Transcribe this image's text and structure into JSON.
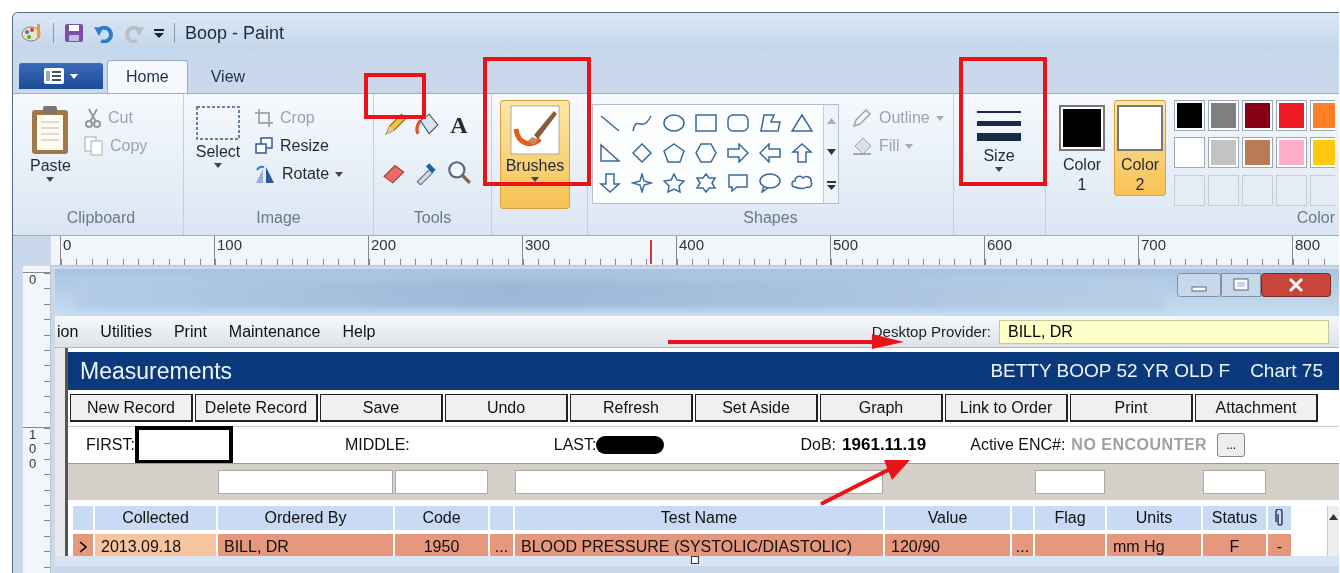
{
  "window": {
    "title": "Boop - Paint"
  },
  "ribbon_tabs": [
    {
      "label": "Home",
      "selected": true
    },
    {
      "label": "View",
      "selected": false
    }
  ],
  "clipboard": {
    "label": "Clipboard",
    "paste": "Paste",
    "cut": {
      "label": "Cut",
      "disabled": true
    },
    "copy": {
      "label": "Copy",
      "disabled": true
    }
  },
  "image": {
    "label": "Image",
    "select": "Select",
    "crop": {
      "label": "Crop",
      "disabled": true
    },
    "resize": {
      "label": "Resize",
      "disabled": false
    },
    "rotate": {
      "label": "Rotate",
      "disabled": false
    }
  },
  "tools": {
    "label": "Tools",
    "text_tool": "A"
  },
  "brushes": {
    "label": "Brushes",
    "selected": true
  },
  "shapes": {
    "label": "Shapes",
    "outline": {
      "label": "Outline",
      "disabled": true
    },
    "fill": {
      "label": "Fill",
      "disabled": true
    }
  },
  "size": {
    "label": "Size",
    "selected": false
  },
  "colors": {
    "label": "Color",
    "slots": [
      {
        "label": "Color 1",
        "color": "#000000",
        "selected": false
      },
      {
        "label": "Color 2",
        "color": "#ffffff",
        "selected": true
      }
    ],
    "palette": [
      [
        {
          "color": "#000000"
        },
        {
          "color": "#7f7f7f"
        },
        {
          "color": "#880015"
        },
        {
          "color": "#ed1c24"
        },
        {
          "color": "#ff7f27"
        }
      ],
      [
        {
          "color": "#ffffff"
        },
        {
          "color": "#c3c3c3"
        },
        {
          "color": "#b97a57"
        },
        {
          "color": "#ffaec9"
        },
        {
          "color": "#ffc90e"
        }
      ],
      [
        {
          "kind": "empty"
        },
        {
          "kind": "empty"
        },
        {
          "kind": "empty"
        },
        {
          "kind": "empty"
        },
        {
          "kind": "empty"
        }
      ]
    ]
  },
  "ruler": {
    "marks": [
      "0",
      "100",
      "200",
      "300",
      "400",
      "500",
      "600",
      "700",
      "800"
    ]
  },
  "vertical_ruler": {
    "marks": [
      "0",
      "100"
    ]
  },
  "app": {
    "menu": [
      "ion",
      "Utilities",
      "Print",
      "Maintenance",
      "Help"
    ],
    "provider": {
      "label": "Desktop Provider:",
      "value": "BILL, DR"
    },
    "header": {
      "title": "Measurements",
      "patient": "BETTY BOOP 52 YR OLD F",
      "chart": "Chart 75"
    },
    "buttons": [
      "New Record",
      "Delete Record",
      "Save",
      "Undo",
      "Refresh",
      "Set Aside",
      "Graph",
      "Link to Order",
      "Print",
      "Attachment"
    ],
    "patient": {
      "first": "FIRST:",
      "middle": "MIDDLE:",
      "last": "LAST:",
      "dob_label": "DoB:",
      "dob": "1961.11.19",
      "enc_label": "Active ENC#:",
      "enc": "NO ENCOUNTER",
      "lookup": "..."
    },
    "table": {
      "columns": [
        {
          "kind": "indicator"
        },
        {
          "label": "Collected"
        },
        {
          "label": "Ordered By",
          "filter": true
        },
        {
          "label": "Code",
          "filter": true
        },
        {
          "kind": "blank"
        },
        {
          "label": "Test Name",
          "filter": true
        },
        {
          "label": "Value"
        },
        {
          "kind": "blank"
        },
        {
          "label": "Flag",
          "filter": true
        },
        {
          "label": "Units"
        },
        {
          "label": "Status",
          "filter": true
        },
        {
          "kind": "attachment"
        }
      ],
      "rows": [
        {
          "cells": [
            {
              "kind": "pointer"
            },
            {
              "text": "2013.09.18",
              "focused": true
            },
            {
              "text": "BILL, DR"
            },
            {
              "text": "1950"
            },
            {
              "text": "..."
            },
            {
              "text": "BLOOD PRESSURE (SYSTOLIC/DIASTOLIC)"
            },
            {
              "text": "120/90"
            },
            {
              "text": "..."
            },
            {
              "kind": "empty"
            },
            {
              "text": "mm Hg"
            },
            {
              "text": "F"
            },
            {
              "text": "-"
            }
          ]
        }
      ]
    }
  }
}
